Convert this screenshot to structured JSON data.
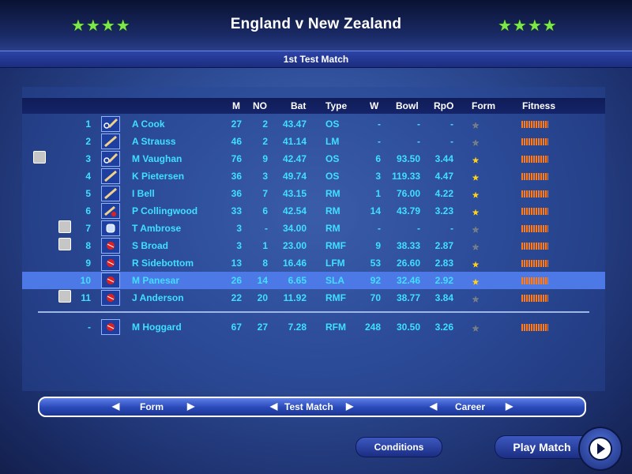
{
  "header": {
    "title": "England v New Zealand",
    "left_stars": "★★★★",
    "right_stars": "★★★★",
    "subtitle": "1st Test Match"
  },
  "table": {
    "columns": {
      "m": "M",
      "no": "NO",
      "bat": "Bat",
      "type": "Type",
      "w": "W",
      "bowl": "Bowl",
      "rpo": "RpO",
      "form": "Form",
      "fitness": "Fitness"
    },
    "rows": [
      {
        "num": "1",
        "name": "A Cook",
        "m": "27",
        "no": "2",
        "bat": "43.47",
        "type": "OS",
        "w": "-",
        "bowl": "-",
        "rpo": "-",
        "form": 2,
        "role": "batsman-keeper-icon"
      },
      {
        "num": "2",
        "name": "A Strauss",
        "m": "46",
        "no": "2",
        "bat": "41.14",
        "type": "LM",
        "w": "-",
        "bowl": "-",
        "rpo": "-",
        "form": 2,
        "role": "bat-icon"
      },
      {
        "num": "3",
        "name": "M Vaughan",
        "m": "76",
        "no": "9",
        "bat": "42.47",
        "type": "OS",
        "w": "6",
        "bowl": "93.50",
        "rpo": "3.44",
        "form": 3,
        "role": "batsman-keeper-icon"
      },
      {
        "num": "4",
        "name": "K Pietersen",
        "m": "36",
        "no": "3",
        "bat": "49.74",
        "type": "OS",
        "w": "3",
        "bowl": "119.33",
        "rpo": "4.47",
        "form": 3,
        "role": "bat-icon"
      },
      {
        "num": "5",
        "name": "I Bell",
        "m": "36",
        "no": "7",
        "bat": "43.15",
        "type": "RM",
        "w": "1",
        "bowl": "76.00",
        "rpo": "4.22",
        "form": 3,
        "role": "bat-icon"
      },
      {
        "num": "6",
        "name": "P Collingwood",
        "m": "33",
        "no": "6",
        "bat": "42.54",
        "type": "RM",
        "w": "14",
        "bowl": "43.79",
        "rpo": "3.23",
        "form": 3,
        "role": "allrounder-icon"
      },
      {
        "num": "7",
        "name": "T Ambrose",
        "m": "3",
        "no": "-",
        "bat": "34.00",
        "type": "RM",
        "w": "-",
        "bowl": "-",
        "rpo": "-",
        "form": 2,
        "role": "keeper-gloves-icon"
      },
      {
        "num": "8",
        "name": "S Broad",
        "m": "3",
        "no": "1",
        "bat": "23.00",
        "type": "RMF",
        "w": "9",
        "bowl": "38.33",
        "rpo": "2.87",
        "form": 2,
        "role": "ball-icon"
      },
      {
        "num": "9",
        "name": "R Sidebottom",
        "m": "13",
        "no": "8",
        "bat": "16.46",
        "type": "LFM",
        "w": "53",
        "bowl": "26.60",
        "rpo": "2.83",
        "form": 3,
        "role": "ball-icon"
      },
      {
        "num": "10",
        "name": "M Panesar",
        "m": "26",
        "no": "14",
        "bat": "6.65",
        "type": "SLA",
        "w": "92",
        "bowl": "32.46",
        "rpo": "2.92",
        "form": 3,
        "role": "ball-icon"
      },
      {
        "num": "11",
        "name": "J Anderson",
        "m": "22",
        "no": "20",
        "bat": "11.92",
        "type": "RMF",
        "w": "70",
        "bowl": "38.77",
        "rpo": "3.84",
        "form": 2,
        "role": "ball-icon"
      }
    ],
    "reserve": {
      "num": "-",
      "name": "M Hoggard",
      "m": "67",
      "no": "27",
      "bat": "7.28",
      "type": "RFM",
      "w": "248",
      "bowl": "30.50",
      "rpo": "3.26",
      "form": 2,
      "role": "ball-icon"
    }
  },
  "nav": {
    "form": "Form",
    "test_match": "Test Match",
    "career": "Career"
  },
  "buttons": {
    "conditions": "Conditions",
    "play_match": "Play Match"
  },
  "colors": {
    "accent_text": "#3fe0ff",
    "selected_row": "#4c79e6",
    "stars": "#7ee84a",
    "fitness": "#ff7a1a"
  }
}
